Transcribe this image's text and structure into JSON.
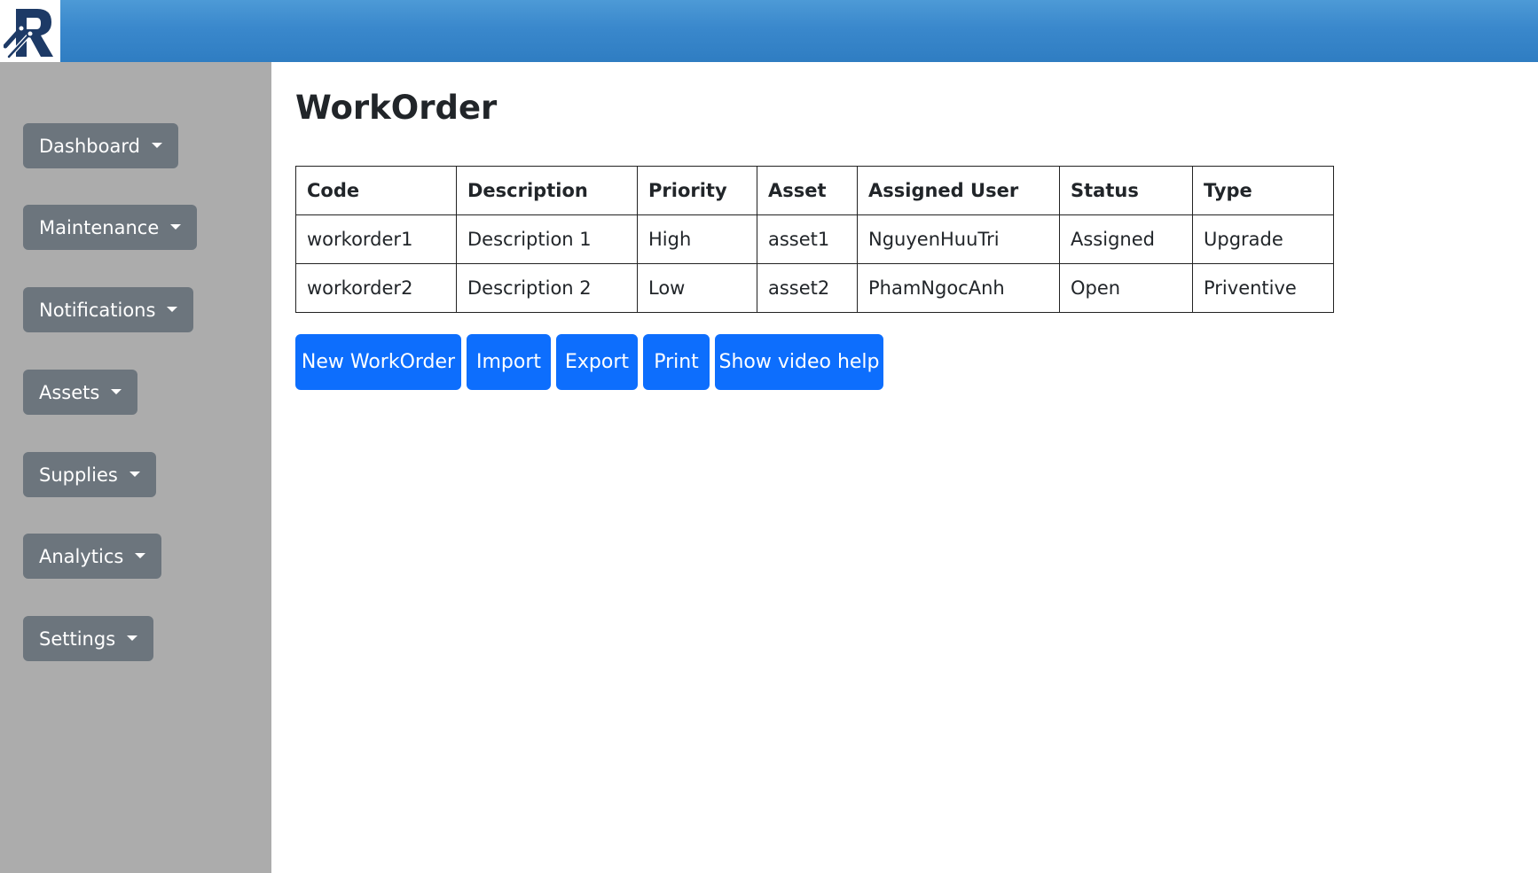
{
  "header": {
    "logo_icon": "brand-logo"
  },
  "sidebar": {
    "items": [
      {
        "label": "Dashboard"
      },
      {
        "label": "Maintenance"
      },
      {
        "label": "Notifications"
      },
      {
        "label": "Assets"
      },
      {
        "label": "Supplies"
      },
      {
        "label": "Analytics"
      },
      {
        "label": "Settings"
      }
    ]
  },
  "main": {
    "title": "WorkOrder",
    "table": {
      "columns": [
        "Code",
        "Description",
        "Priority",
        "Asset",
        "Assigned User",
        "Status",
        "Type"
      ],
      "rows": [
        [
          "workorder1",
          "Description 1",
          "High",
          "asset1",
          "NguyenHuuTri",
          "Assigned",
          "Upgrade"
        ],
        [
          "workorder2",
          "Description 2",
          "Low",
          "asset2",
          "PhamNgocAnh",
          "Open",
          "Priventive"
        ]
      ]
    },
    "actions": {
      "new_workorder": "New WorkOrder",
      "import": "Import",
      "export": "Export",
      "print": "Print",
      "video_help": "Show video help"
    }
  },
  "colors": {
    "header_gradient_top": "#4d9ad6",
    "header_gradient_bottom": "#2f7dc2",
    "sidebar_bg": "#acacac",
    "nav_button_bg": "#6c757d",
    "primary_button_bg": "#0d6efd",
    "logo_navy": "#1d3a66"
  }
}
